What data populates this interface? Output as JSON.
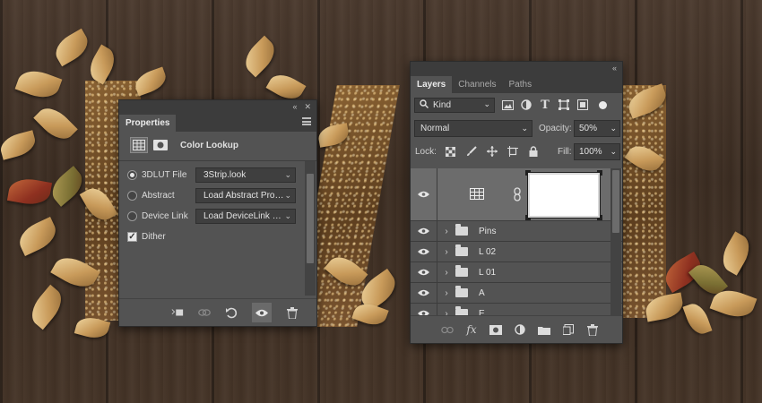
{
  "properties": {
    "tab": "Properties",
    "icons": [
      "adjustment-grid-icon",
      "mask-icon"
    ],
    "title": "Color Lookup",
    "options": [
      {
        "label": "3DLUT File",
        "value": "3Strip.look",
        "selected": true
      },
      {
        "label": "Abstract",
        "value": "Load Abstract Profile...",
        "selected": false
      },
      {
        "label": "Device Link",
        "value": "Load DeviceLink Profile...",
        "selected": false
      }
    ],
    "dither": {
      "label": "Dither",
      "checked": true
    },
    "bottom_icons": [
      "clip-to-layer-icon",
      "view-previous-state-icon",
      "reset-icon",
      "visibility-eye-icon",
      "trash-icon"
    ]
  },
  "layers": {
    "tabs": [
      "Layers",
      "Channels",
      "Paths"
    ],
    "active_tab": "Layers",
    "filter": {
      "label": "Kind"
    },
    "blend_mode": "Normal",
    "opacity": {
      "label": "Opacity:",
      "value": "50%"
    },
    "lock": {
      "label": "Lock:"
    },
    "fill": {
      "label": "Fill:",
      "value": "100%"
    },
    "rows": [
      {
        "name": "",
        "type": "adjustment",
        "selected": true
      },
      {
        "name": "Pins",
        "type": "group"
      },
      {
        "name": "L 02",
        "type": "group"
      },
      {
        "name": "L 01",
        "type": "group"
      },
      {
        "name": "A",
        "type": "group"
      },
      {
        "name": "E",
        "type": "group"
      }
    ],
    "bottom_icons": [
      "link-layers-icon",
      "fx-icon",
      "add-mask-icon",
      "adjustment-layer-icon",
      "new-group-icon",
      "new-layer-icon",
      "trash-icon"
    ]
  },
  "colors": {
    "panel": "#535353",
    "panel_dark": "#3c3c3c",
    "selected_row": "#6c6c6c"
  }
}
